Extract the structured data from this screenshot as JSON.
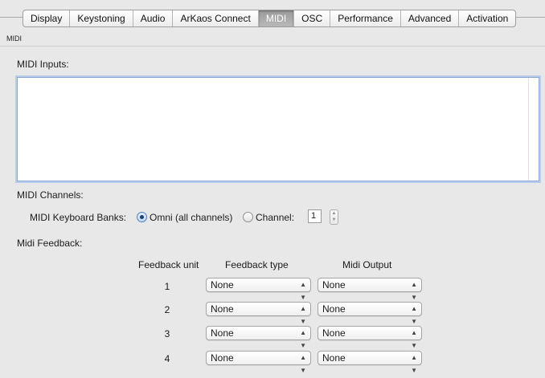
{
  "tabs": [
    {
      "label": "Display"
    },
    {
      "label": "Keystoning"
    },
    {
      "label": "Audio"
    },
    {
      "label": "ArKaos Connect"
    },
    {
      "label": "MIDI",
      "active": true
    },
    {
      "label": "OSC"
    },
    {
      "label": "Performance"
    },
    {
      "label": "Advanced"
    },
    {
      "label": "Activation"
    }
  ],
  "section_tag": "MIDI",
  "midi_inputs": {
    "label": "MIDI Inputs:",
    "items": []
  },
  "midi_channels": {
    "label": "MIDI Channels:",
    "keyboard_banks_label": "MIDI Keyboard Banks:",
    "omni_label": "Omni (all channels)",
    "omni_selected": true,
    "channel_label": "Channel:",
    "channel_value": "1"
  },
  "midi_feedback": {
    "label": "Midi Feedback:",
    "headers": {
      "unit": "Feedback unit",
      "type": "Feedback type",
      "output": "Midi Output"
    },
    "rows": [
      {
        "unit": "1",
        "type": "None",
        "output": "None"
      },
      {
        "unit": "2",
        "type": "None",
        "output": "None"
      },
      {
        "unit": "3",
        "type": "None",
        "output": "None"
      },
      {
        "unit": "4",
        "type": "None",
        "output": "None"
      }
    ]
  },
  "colors": {
    "focus_ring": "#b7cdee",
    "active_tab": "#9a9a9a",
    "background": "#e8e8e8"
  }
}
